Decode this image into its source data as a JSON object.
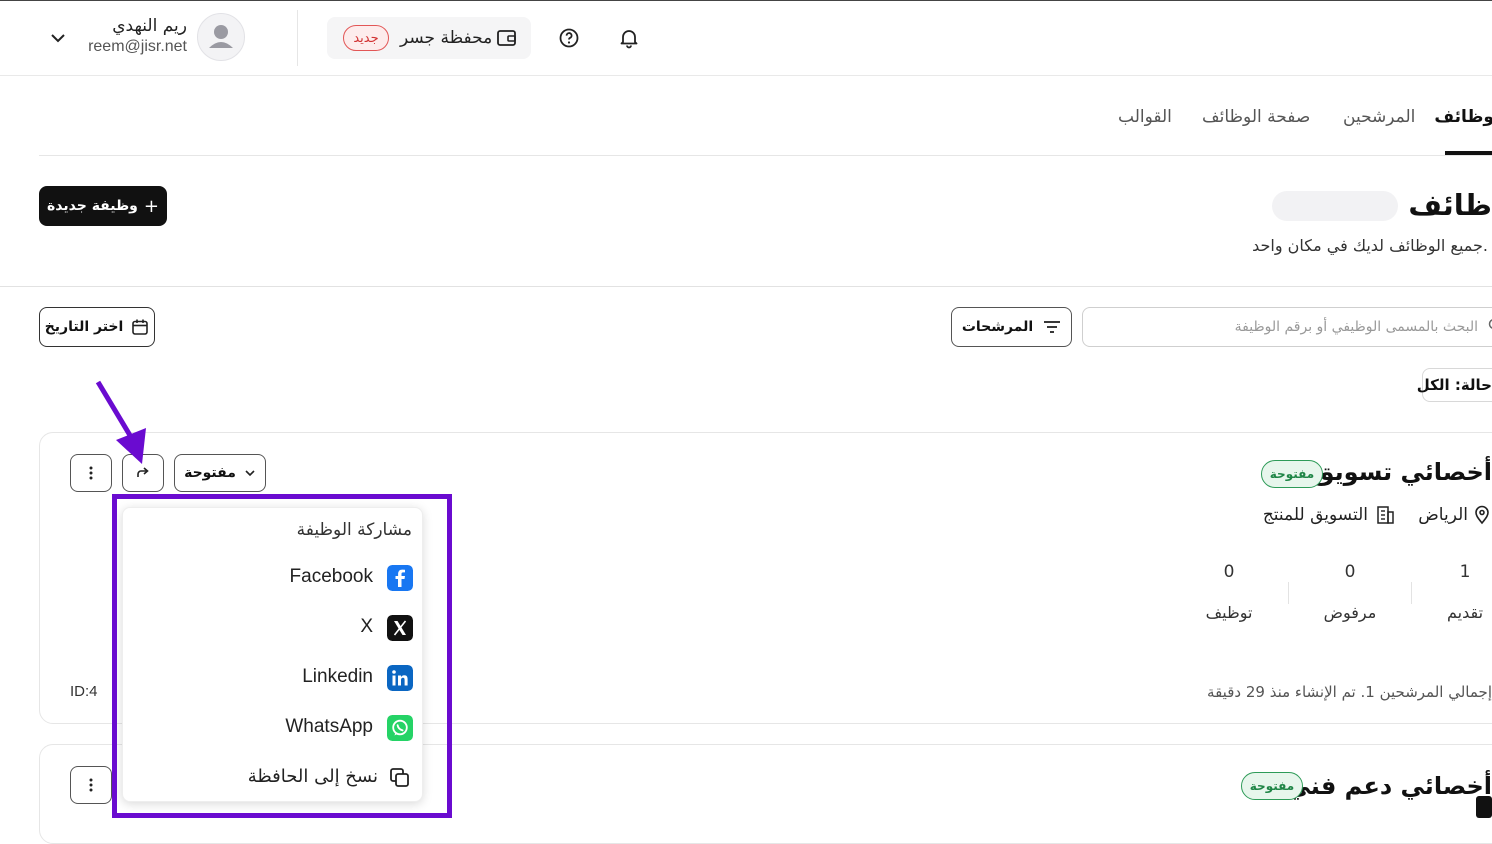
{
  "header": {
    "user_name": "ريم النهدي",
    "user_email": "reem@jisr.net",
    "wallet_label": "محفظة جسر",
    "wallet_badge": "جديد",
    "icons": [
      "chevron-down-icon",
      "avatar-icon",
      "wallet-icon",
      "help-icon",
      "bell-icon"
    ]
  },
  "tabs": [
    {
      "label": "وظائف",
      "active": true
    },
    {
      "label": "المرشحين",
      "active": false
    },
    {
      "label": "صفحة الوظائف",
      "active": false
    },
    {
      "label": "القوالب",
      "active": false
    }
  ],
  "page": {
    "title": "ظائف",
    "subtitle": "جميع الوظائف لديك في مكان واحد.",
    "new_job_button": "وظيفة جديدة",
    "new_job_icon": "+"
  },
  "toolbar": {
    "search_placeholder": "البحث بالمسمى الوظيفي أو برقم الوظيفة",
    "filters_button": "المرشحات",
    "date_button": "اختر التاريخ",
    "status_filter": "حالة: الكل"
  },
  "jobs": [
    {
      "title": "أخصائي تسويق",
      "status_badge": "مفتوحة",
      "status_dropdown": "مفتوحة",
      "location": "الرياض",
      "department": "التسويق للمنتج",
      "stats": [
        {
          "label": "تقديم",
          "value": "1"
        },
        {
          "label": "مرفوض",
          "value": "0"
        },
        {
          "label": "توظيف",
          "value": "0"
        }
      ],
      "footer": "إجمالي المرشحين 1. تم الإنشاء منذ 29 دقيقة",
      "id": "ID:4"
    },
    {
      "title": "أخصائي دعم فني",
      "status_badge": "مفتوحة"
    }
  ],
  "share_menu": {
    "heading": "مشاركة الوظيفة",
    "items": [
      {
        "label": "Facebook",
        "icon": "facebook-icon",
        "color": "#1877F2"
      },
      {
        "label": "X",
        "icon": "x-icon",
        "color": "#111111"
      },
      {
        "label": "Linkedin",
        "icon": "linkedin-icon",
        "color": "#0A66C2"
      },
      {
        "label": "WhatsApp",
        "icon": "whatsapp-icon",
        "color": "#25D366"
      },
      {
        "label": "نسخ إلى الحافظة",
        "icon": "copy-icon",
        "color": "#222222"
      }
    ]
  },
  "annotation": {
    "highlight_color": "#6a0bd0"
  }
}
